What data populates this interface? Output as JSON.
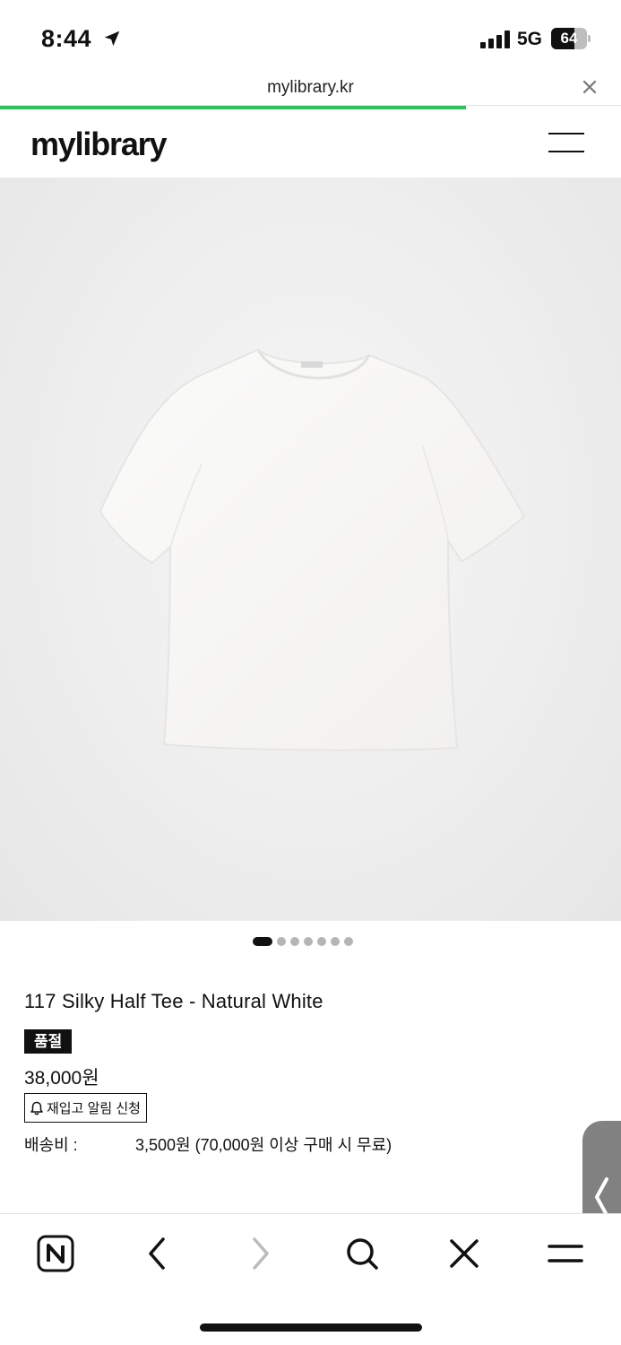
{
  "status_bar": {
    "time": "8:44",
    "network": "5G",
    "battery_percent": "64",
    "battery_level": 0.64
  },
  "url_bar": {
    "url": "mylibrary.kr",
    "load_progress": 0.75
  },
  "header": {
    "logo": "mylibrary"
  },
  "carousel": {
    "total_images": 7,
    "active_index": 0
  },
  "product": {
    "title": "117 Silky Half Tee - Natural White",
    "badge": "품절",
    "price": "38,000원",
    "restock_button": "재입고 알림 신청",
    "shipping_label": "배송비 :",
    "shipping_value": "3,500원 (70,000원 이상 구매 시 무료)"
  },
  "icons": {
    "location": "location-arrow-icon",
    "close": "close-icon",
    "menu": "hamburger-icon",
    "bell": "bell-icon",
    "side_tab": "chevron-left-icon",
    "naver": "naver-n-icon",
    "back": "back-icon",
    "forward": "forward-icon",
    "search": "search-icon",
    "close_tab": "close-tab-icon",
    "more": "menu-icon"
  },
  "colors": {
    "progress": "#2fc15b",
    "badge_bg": "#111111",
    "text": "#111111"
  }
}
